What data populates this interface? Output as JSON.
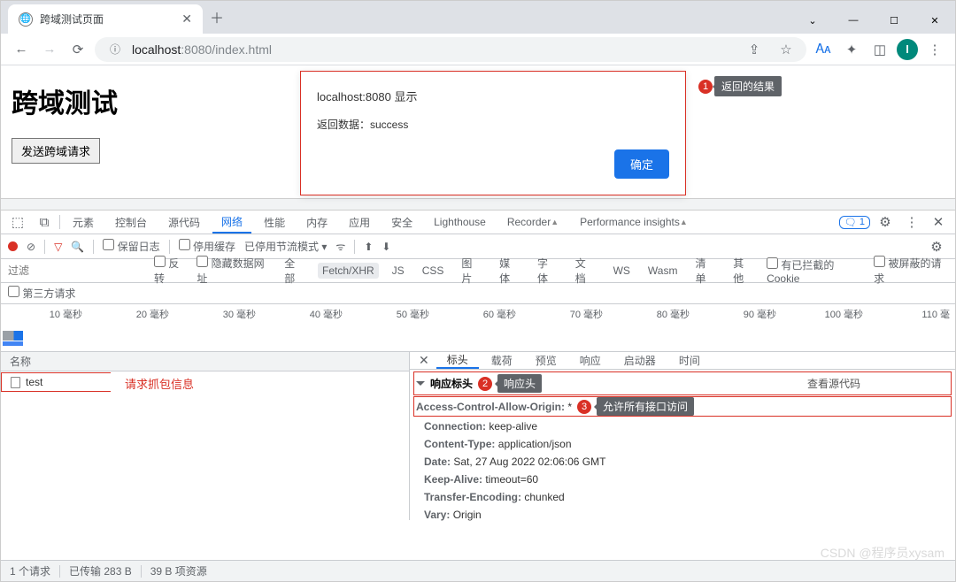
{
  "browser_tab": {
    "title": "跨域测试页面"
  },
  "addr": {
    "host": "localhost",
    "port_and_path": ":8080/index.html",
    "avatar_letter": "I"
  },
  "page": {
    "h1": "跨域测试",
    "button": "发送跨域请求"
  },
  "dialog": {
    "title": "localhost:8080 显示",
    "body": "返回数据：success",
    "ok": "确定"
  },
  "anno": {
    "a1": "返回的结果",
    "a2": "响应头",
    "a3": "允许所有接口访问",
    "req_info": "请求抓包信息"
  },
  "devtools": {
    "tabs": [
      "元素",
      "控制台",
      "源代码",
      "网络",
      "性能",
      "内存",
      "应用",
      "安全",
      "Lighthouse",
      "Recorder",
      "Performance insights"
    ],
    "messages_count": "1",
    "sub": {
      "preserve": "保留日志",
      "disable_cache": "停用缓存",
      "throttle": "已停用节流模式"
    },
    "filter": {
      "placeholder": "过滤",
      "reverse": "反转",
      "hide_data": "隐藏数据网址",
      "types": [
        "全部",
        "Fetch/XHR",
        "JS",
        "CSS",
        "图片",
        "媒体",
        "字体",
        "文档",
        "WS",
        "Wasm",
        "清单",
        "其他"
      ],
      "blocked_cookie": "有已拦截的 Cookie",
      "blocked_req": "被屏蔽的请求",
      "third_party": "第三方请求"
    },
    "timeline_labels": [
      "10 毫秒",
      "20 毫秒",
      "30 毫秒",
      "40 毫秒",
      "50 毫秒",
      "60 毫秒",
      "70 毫秒",
      "80 毫秒",
      "90 毫秒",
      "100 毫秒",
      "110 毫"
    ],
    "list": {
      "header": "名称",
      "rows": [
        "test"
      ]
    },
    "detail": {
      "tabs": [
        "标头",
        "载荷",
        "预览",
        "响应",
        "启动器",
        "时间"
      ],
      "resp_headers": "响应标头",
      "view_source": "查看源代码",
      "headers": [
        {
          "k": "Access-Control-Allow-Origin:",
          "v": " *"
        },
        {
          "k": "Connection:",
          "v": " keep-alive"
        },
        {
          "k": "Content-Type:",
          "v": " application/json"
        },
        {
          "k": "Date:",
          "v": " Sat, 27 Aug 2022 02:06:06 GMT"
        },
        {
          "k": "Keep-Alive:",
          "v": " timeout=60"
        },
        {
          "k": "Transfer-Encoding:",
          "v": " chunked"
        },
        {
          "k": "Vary:",
          "v": " Origin"
        }
      ]
    },
    "status": {
      "req": "1 个请求",
      "transfer": "已传输 283 B",
      "res": "39 B 项资源"
    }
  },
  "watermark": "CSDN @程序员xysam"
}
